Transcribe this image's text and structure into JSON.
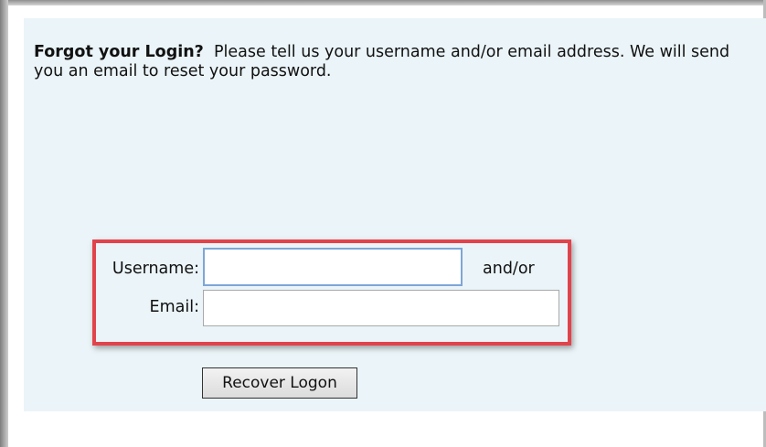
{
  "intro": {
    "lead": "Forgot your Login?",
    "text": "Please tell us your username and/or email address. We will send you an email to reset your password."
  },
  "form": {
    "username_label": "Username:",
    "username_value": "",
    "email_label": "Email:",
    "email_value": "",
    "and_or": "and/or",
    "submit_label": "Recover Logon"
  },
  "colors": {
    "panel_background": "#ebf4f8",
    "highlight_border": "#e2434b",
    "focused_input_border": "#7ea6d6"
  }
}
